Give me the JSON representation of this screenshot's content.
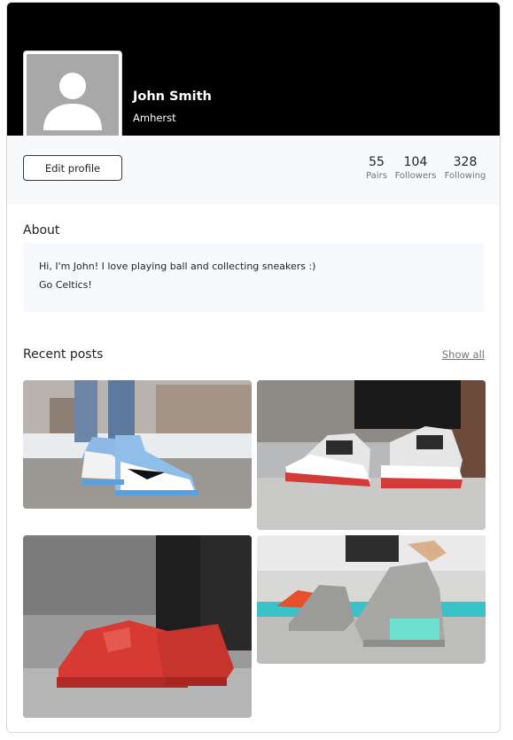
{
  "profile": {
    "name": "John Smith",
    "location": "Amherst",
    "edit_label": "Edit profile"
  },
  "stats": [
    {
      "value": "55",
      "label": "Pairs"
    },
    {
      "value": "104",
      "label": "Followers"
    },
    {
      "value": "328",
      "label": "Following"
    }
  ],
  "about": {
    "title": "About",
    "lines": [
      "Hi, I'm John! I love playing ball and collecting sneakers :)",
      "Go Celtics!"
    ]
  },
  "recent_posts": {
    "title": "Recent posts",
    "show_all_label": "Show all"
  },
  "icons": {
    "avatar": "person-placeholder-icon"
  },
  "colors": {
    "cover": "#000000",
    "meta_bar": "#f8f9fa",
    "about_box": "#f8f9fa"
  }
}
